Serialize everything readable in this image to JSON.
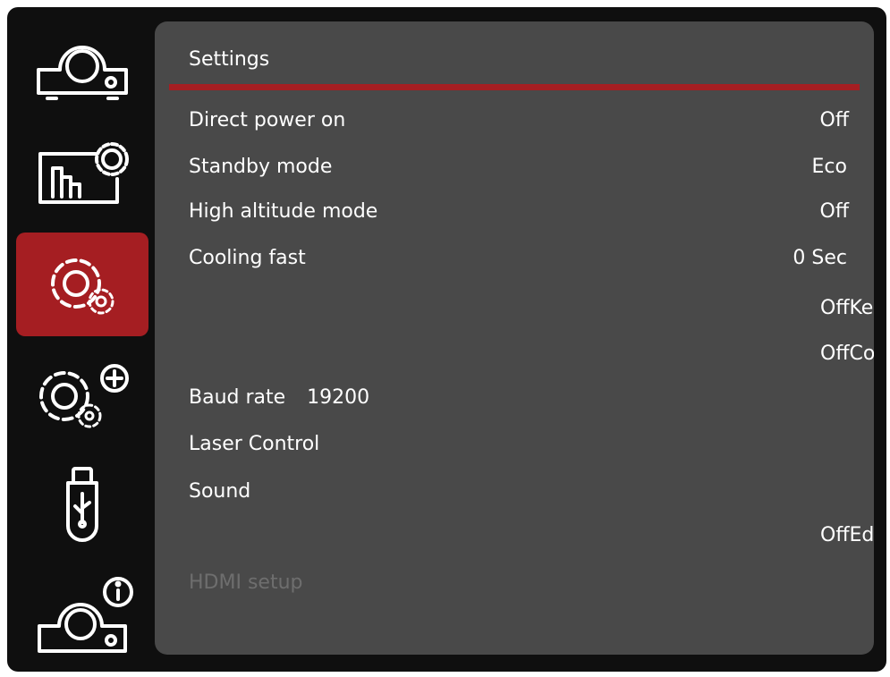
{
  "sidebar": {
    "items": [
      {
        "icon": "projector-icon"
      },
      {
        "icon": "display-settings-icon"
      },
      {
        "icon": "settings-gears-icon",
        "active": true
      },
      {
        "icon": "advanced-settings-icon"
      },
      {
        "icon": "usb-icon"
      },
      {
        "icon": "projector-info-icon"
      }
    ]
  },
  "panel": {
    "title": "Settings",
    "rows": {
      "direct_power_on": {
        "label": "Direct power on",
        "value": "Off"
      },
      "standby_mode": {
        "label": "Standby mode",
        "value": "Eco"
      },
      "high_altitude_mode": {
        "label": "High altitude mode",
        "value": "Off"
      },
      "cooling_fast": {
        "label": "Cooling fast",
        "value": "0 Sec"
      },
      "baud_rate": {
        "label": "Baud rate",
        "value": "19200"
      },
      "laser_control": {
        "label": "Laser Control"
      },
      "sound": {
        "label": "Sound"
      },
      "hdmi_setup": {
        "label": "HDMI setup",
        "disabled": true
      }
    },
    "floating_values": {
      "offkey": "OffKey",
      "offcon": "OffCon",
      "offedge": "OffEdge"
    }
  },
  "colors": {
    "accent": "#a51e22",
    "panel_bg": "#494949",
    "frame_bg": "#0f0f0f",
    "text": "#ffffff",
    "disabled_text": "#6e6e6e"
  }
}
